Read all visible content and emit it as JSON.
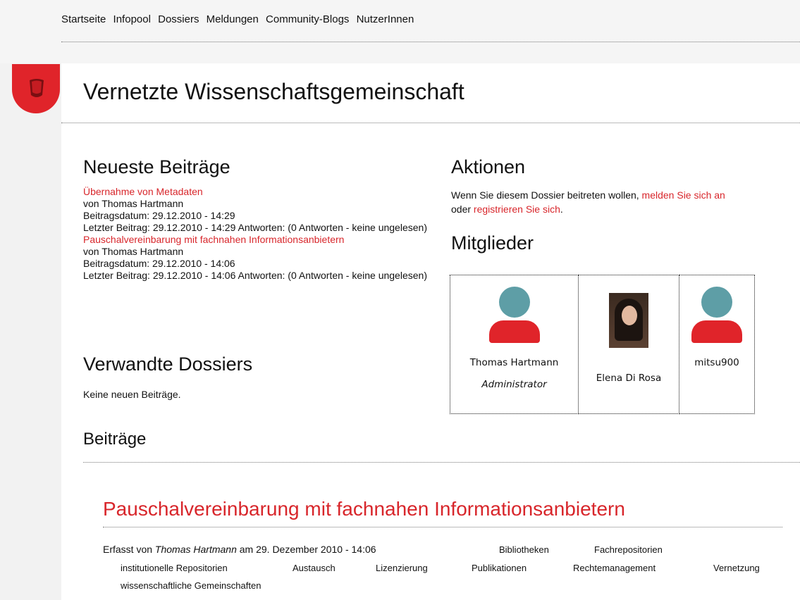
{
  "nav": {
    "items": [
      "Startseite",
      "Infopool",
      "Dossiers",
      "Meldungen",
      "Community-Blogs",
      "NutzerInnen"
    ]
  },
  "header": {
    "title": "Vernetzte Wissenschaftsgemeinschaft"
  },
  "neueste": {
    "heading": "Neueste Beiträge",
    "posts": [
      {
        "title": "Übernahme von Metadaten",
        "author": "von Thomas Hartmann",
        "date": "Beitragsdatum: 29.12.2010 - 14:29",
        "last": "Letzter Beitrag: 29.12.2010 - 14:29 Antworten: (0 Antworten - keine ungelesen)"
      },
      {
        "title": "Pauschalvereinbarung mit fachnahen Informationsanbietern",
        "author": "von Thomas Hartmann",
        "date": "Beitragsdatum: 29.12.2010 - 14:06",
        "last": "Letzter Beitrag: 29.12.2010 - 14:06 Antworten: (0 Antworten - keine ungelesen)"
      }
    ]
  },
  "verwandte": {
    "heading": "Verwandte Dossiers",
    "text": "Keine neuen Beiträge."
  },
  "aktionen": {
    "heading": "Aktionen",
    "text_before": "Wenn Sie diesem Dossier beitreten wollen, ",
    "login_link": "melden Sie sich an",
    "text_or": "oder ",
    "register_link": "registrieren Sie sich",
    "text_end": "."
  },
  "mitglieder": {
    "heading": "Mitglieder",
    "members": [
      {
        "name": "Thomas Hartmann",
        "role": "Administrator"
      },
      {
        "name": "Elena Di Rosa"
      },
      {
        "name": "mitsu900"
      }
    ]
  },
  "beitraege": {
    "heading": "Beiträge",
    "article": {
      "title": "Pauschalvereinbarung mit fachnahen Informationsanbietern",
      "meta_prefix": "Erfasst von ",
      "meta_author": "Thomas Hartmann",
      "meta_suffix": " am 29. Dezember 2010 - 14:06",
      "tags": [
        "Bibliotheken",
        "Fachrepositorien",
        "institutionelle Repositorien",
        "Austausch",
        "Lizenzierung",
        "Publikationen",
        "Rechtemanagement",
        "Vernetzung",
        "wissenschaftliche Gemeinschaften"
      ]
    }
  },
  "colors": {
    "accent": "#d8262b",
    "avatar_head": "#5e9ea6"
  }
}
